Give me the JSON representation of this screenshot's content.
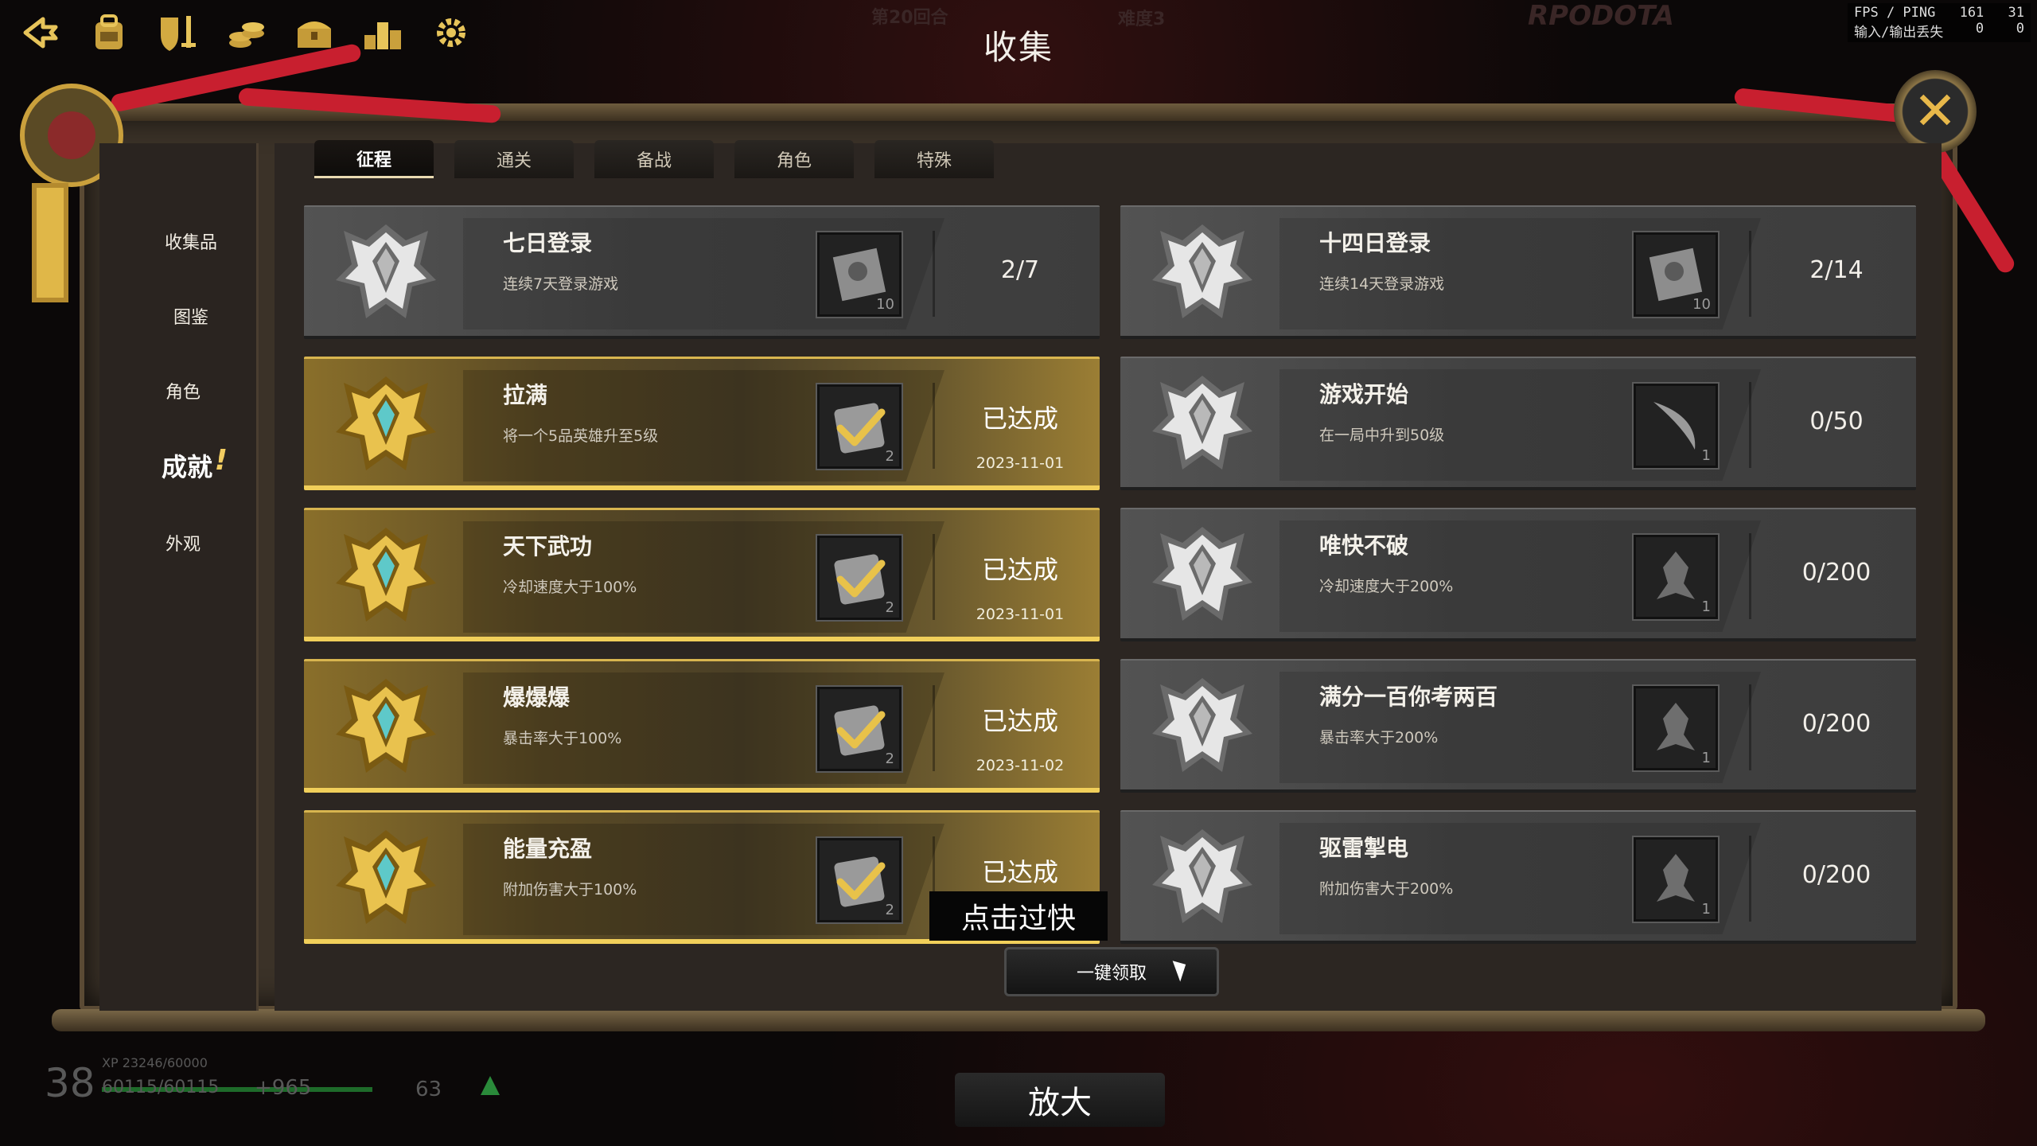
{
  "title": "收集",
  "background": {
    "round_text": "第20回合",
    "difficulty_text": "难度3",
    "logo_text": "RPODOTA"
  },
  "stats": {
    "fps_label": "FPS / PING",
    "fps_value": "161",
    "ping_value": "31",
    "io_label": "输入/输出丢失",
    "in_value": "0",
    "out_value": "0"
  },
  "toolbar": [
    {
      "name": "back-icon"
    },
    {
      "name": "backpack-icon"
    },
    {
      "name": "shield-sword-icon"
    },
    {
      "name": "coins-icon"
    },
    {
      "name": "treasure-chest-icon"
    },
    {
      "name": "ranking-podium-icon"
    },
    {
      "name": "gear-icon"
    }
  ],
  "sidebar": {
    "items": [
      {
        "label": "收集品",
        "active": false
      },
      {
        "label": "图鉴",
        "active": false
      },
      {
        "label": "角色",
        "active": false
      },
      {
        "label": "成就",
        "active": true
      },
      {
        "label": "外观",
        "active": false
      }
    ]
  },
  "tabs": [
    {
      "label": "征程",
      "active": true
    },
    {
      "label": "通关",
      "active": false
    },
    {
      "label": "备战",
      "active": false
    },
    {
      "label": "角色",
      "active": false
    },
    {
      "label": "特殊",
      "active": false
    }
  ],
  "achievements": [
    {
      "name": "七日登录",
      "desc": "连续7天登录游戏",
      "reward_icon": "scroll-map-icon",
      "reward_qty": "10",
      "progress": "2/7",
      "done": false
    },
    {
      "name": "十四日登录",
      "desc": "连续14天登录游戏",
      "reward_icon": "scroll-map-icon",
      "reward_qty": "10",
      "progress": "2/14",
      "done": false
    },
    {
      "name": "拉满",
      "desc": "将一个5品英雄升至5级",
      "reward_icon": "check-token-icon",
      "reward_qty": "2",
      "status": "已达成",
      "date": "2023-11-01",
      "done": true
    },
    {
      "name": "游戏开始",
      "desc": "在一局中升到50级",
      "reward_icon": "scimitar-icon",
      "reward_qty": "1",
      "progress": "0/50",
      "done": false
    },
    {
      "name": "天下武功",
      "desc": "冷却速度大于100%",
      "reward_icon": "check-token-icon",
      "reward_qty": "2",
      "status": "已达成",
      "date": "2023-11-01",
      "done": true
    },
    {
      "name": "唯快不破",
      "desc": "冷却速度大于200%",
      "reward_icon": "beast-statue-icon",
      "reward_qty": "1",
      "progress": "0/200",
      "done": false
    },
    {
      "name": "爆爆爆",
      "desc": "暴击率大于100%",
      "reward_icon": "check-token-icon",
      "reward_qty": "2",
      "status": "已达成",
      "date": "2023-11-02",
      "done": true
    },
    {
      "name": "满分一百你考两百",
      "desc": "暴击率大于200%",
      "reward_icon": "creature-statue-icon",
      "reward_qty": "1",
      "progress": "0/200",
      "done": false
    },
    {
      "name": "能量充盈",
      "desc": "附加伤害大于100%",
      "reward_icon": "check-token-icon",
      "reward_qty": "2",
      "status": "已达成",
      "date": "",
      "done": true
    },
    {
      "name": "驱雷掣电",
      "desc": "附加伤害大于200%",
      "reward_icon": "dragon-head-icon",
      "reward_qty": "1",
      "progress": "0/200",
      "done": false
    }
  ],
  "toast": "点击过快",
  "claim_all_label": "一键领取",
  "zoom_label": "放大",
  "hud": {
    "level": "38",
    "xp_text": "XP 23246/60000",
    "hp_text": "60115/60115",
    "regen_text": "+965",
    "mana_text": "63",
    "hp_fraction": 1.0
  },
  "colors": {
    "accent_gold": "#f1cf5a",
    "ribbon_red": "#c81f2f",
    "card_gray": "#474747"
  }
}
